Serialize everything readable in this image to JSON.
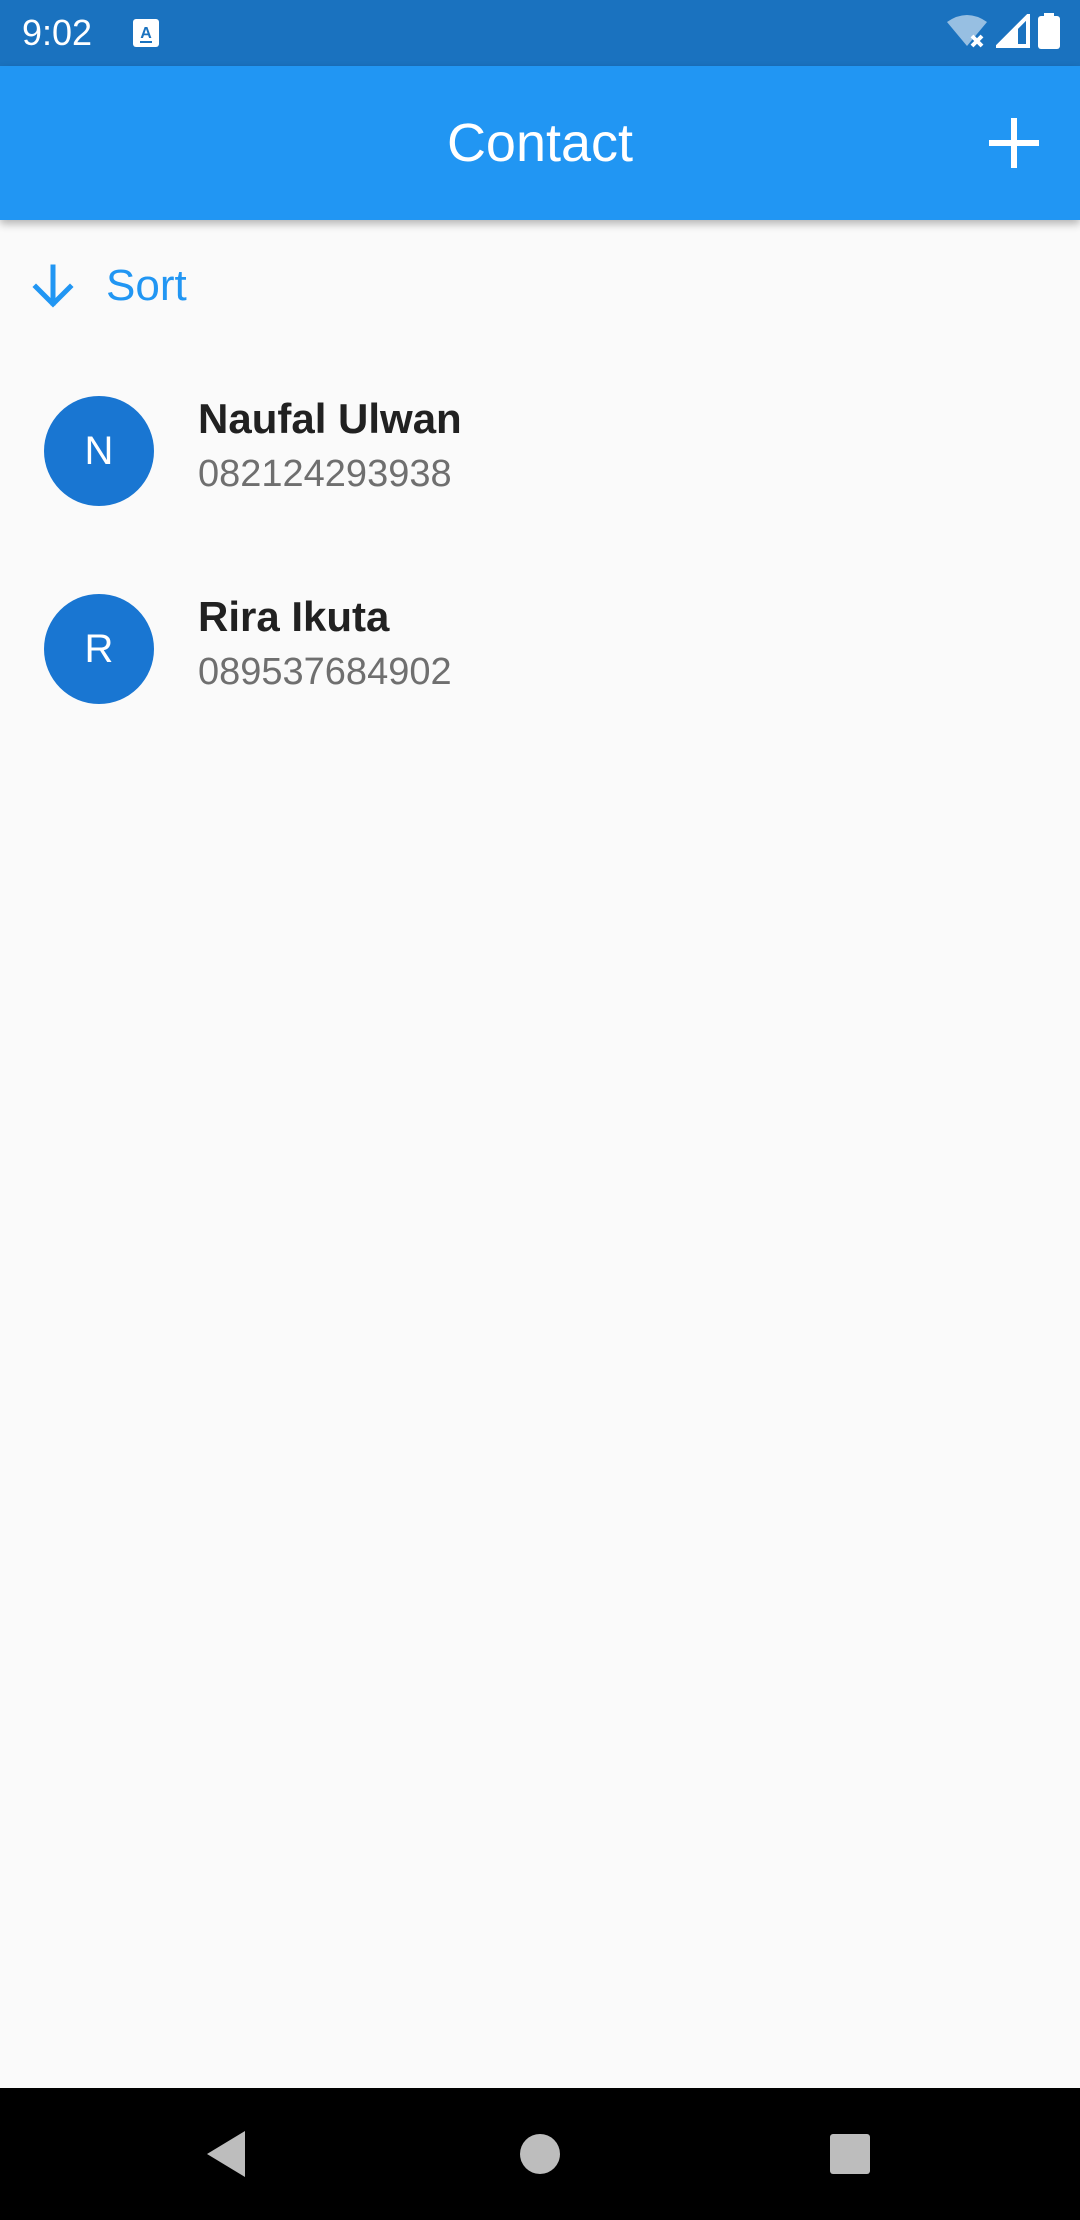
{
  "status_bar": {
    "time": "9:02",
    "notification_icon": "text-input-notification-icon",
    "wifi_icon": "wifi-no-internet-icon",
    "signal_icon": "cell-signal-icon",
    "battery_icon": "battery-icon"
  },
  "app_bar": {
    "title": "Contact",
    "add_icon": "plus-icon",
    "background_color": "#2196f3"
  },
  "sort": {
    "label": "Sort",
    "icon": "arrow-down-icon",
    "color": "#2196f3"
  },
  "contacts": [
    {
      "initial": "N",
      "name": "Naufal Ulwan",
      "phone": "082124293938"
    },
    {
      "initial": "R",
      "name": "Rira Ikuta",
      "phone": "089537684902"
    }
  ],
  "avatar_color": "#1976d2",
  "nav_bar": {
    "back_icon": "back-triangle-icon",
    "home_icon": "home-circle-icon",
    "recents_icon": "recents-square-icon"
  }
}
